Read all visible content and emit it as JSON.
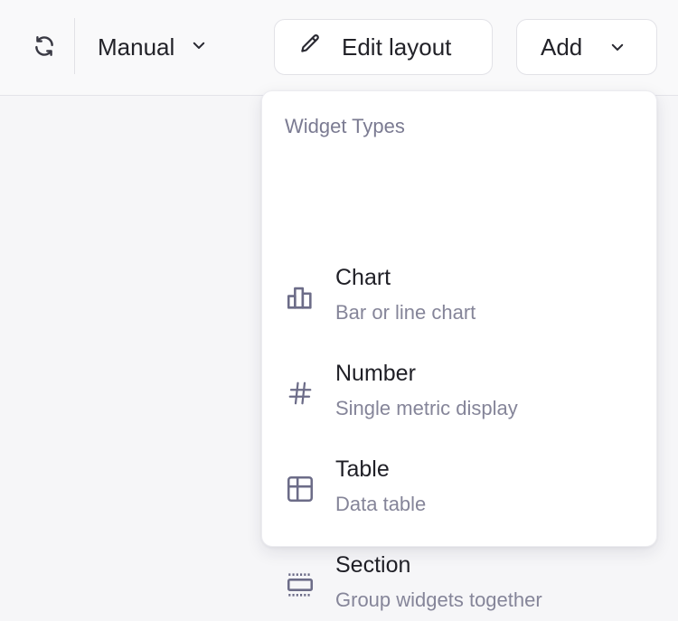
{
  "toolbar": {
    "refresh_icon": "refresh-icon",
    "mode_label": "Manual",
    "edit_layout_label": "Edit layout",
    "add_label": "Add"
  },
  "widget_menu": {
    "title": "Widget Types",
    "items": [
      {
        "name": "Chart",
        "description": "Bar or line chart",
        "icon": "bar-chart-icon"
      },
      {
        "name": "Number",
        "description": "Single metric display",
        "icon": "hash-icon"
      },
      {
        "name": "Table",
        "description": "Data table",
        "icon": "table-icon"
      },
      {
        "name": "Section",
        "description": "Group widgets together",
        "icon": "section-icon"
      }
    ]
  },
  "colors": {
    "background": "#f6f6f8",
    "menu_background": "#ffffff",
    "icon_color": "#6c6c88",
    "secondary_text": "#858599"
  }
}
